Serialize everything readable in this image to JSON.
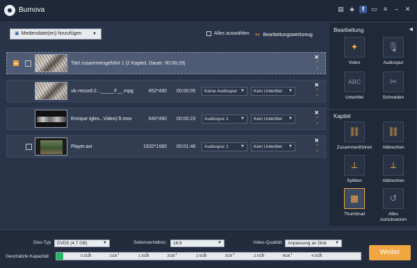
{
  "app": {
    "title": "Burnova"
  },
  "toolbar": {
    "add_media_label": "Mediendatei(en) hinzufügen",
    "select_all_label": "Alles auswählen",
    "edit_tool_label": "Bearbeitungswerkzeug"
  },
  "title_row": {
    "name": "Titel zusammengeführt 1 (2 Kapitel, Dauer: 00:00:29)"
  },
  "files": [
    {
      "name": "vlc-record-2..._____F__.mpg",
      "resolution": "852*480",
      "duration": "00:00:05",
      "audio": "Keine Audiospur",
      "subtitle": "Kein Untertitel"
    },
    {
      "name": "Enrique Igles...Video) ft.mov",
      "resolution": "640*480",
      "duration": "00:00:23",
      "audio": "Audiospur 1",
      "subtitle": "Kein Untertitel"
    },
    {
      "name": "Player.avi",
      "resolution": "1920*1080",
      "duration": "00:01:46",
      "audio": "Audiospur 1",
      "subtitle": "Kein Untertitel"
    }
  ],
  "panel": {
    "edit_heading": "Bearbeitung",
    "edit_tools": [
      {
        "label": "Video",
        "icon": "wand-icon"
      },
      {
        "label": "Audiospur",
        "icon": "microphone-icon"
      },
      {
        "label": "Untertitel",
        "icon": "abc-icon"
      },
      {
        "label": "Schneiden",
        "icon": "scissors-icon"
      }
    ],
    "chapter_heading": "Kapitel",
    "chapter_tools": [
      {
        "label": "Zusammenführen",
        "icon": "link-icon"
      },
      {
        "label": "Abbrechen",
        "icon": "unlink-icon"
      },
      {
        "label": "Splitten",
        "icon": "split-icon"
      },
      {
        "label": "Abbrechen",
        "icon": "unsplit-icon"
      },
      {
        "label": "Thumbnail",
        "icon": "thumbnail-icon"
      },
      {
        "label": "Alles zurücksetzen",
        "icon": "reset-icon"
      }
    ]
  },
  "settings": {
    "disc_type_label": "Disc-Typ",
    "disc_type_value": "DVD5 (4.7 GB)",
    "aspect_label": "Seitenverhältnis:",
    "aspect_value": "16:9",
    "quality_label": "Video-Qualität:",
    "quality_value": "Anpassung an Disk",
    "capacity_label": "Geschätzte Kapazität:"
  },
  "capacity": {
    "ticks": [
      "0.5GB",
      "1GB",
      "1.5GB",
      "2GB",
      "2.5GB",
      "3GB",
      "3.5GB",
      "4GB",
      "4.5GB"
    ],
    "used_fraction": 0.02
  },
  "actions": {
    "next_label": "Weiter"
  }
}
